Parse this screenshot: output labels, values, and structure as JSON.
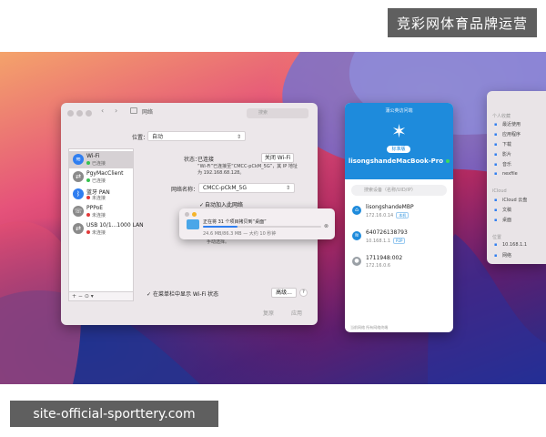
{
  "watermarks": {
    "top": "竞彩网体育品牌运营",
    "bottom": "site-official-sporttery.com"
  },
  "network_window": {
    "title": "网络",
    "search_placeholder": "搜索",
    "location_label": "位置：",
    "location_value": "自动",
    "services": [
      {
        "name": "Wi-Fi",
        "status": "已连接",
        "status_color": "#35c14f",
        "icon": "wifi-icon",
        "glyph": "≋",
        "icon_bg": "#2f7ef0"
      },
      {
        "name": "PgyMacClient",
        "status": "已连接",
        "status_color": "#35c14f",
        "icon": "network-adapter-icon",
        "glyph": "⇄",
        "icon_bg": "#8a8a8a"
      },
      {
        "name": "蓝牙 PAN",
        "status": "未连接",
        "status_color": "#e23b3b",
        "icon": "bluetooth-icon",
        "glyph": "ᛒ",
        "icon_bg": "#2f7ef0"
      },
      {
        "name": "PPPoE",
        "status": "未连接",
        "status_color": "#e23b3b",
        "icon": "phone-icon",
        "glyph": "☏",
        "icon_bg": "#8a8a8a"
      },
      {
        "name": "USB 10/1...1000 LAN",
        "status": "未连接",
        "status_color": "#e23b3b",
        "icon": "ethernet-icon",
        "glyph": "⇄",
        "icon_bg": "#8a8a8a"
      }
    ],
    "sidebar_tools": "+  −  ⊙ ▾",
    "status_label": "状态：",
    "status_value": "已连接",
    "turn_off_wifi": "关闭 Wi-Fi",
    "status_description": "“Wi-Fi”已连接至“CMCC-pCkM_5G”，其 IP 地址为 192.168.68.128。",
    "network_name_label": "网络名称：",
    "network_name_value": "CMCC-pCkM_5G",
    "auto_join_label": "自动加入此网络",
    "ask_text": "手动选择。",
    "show_wifi_label": "在菜单栏中显示 Wi-Fi 状态",
    "advanced_label": "高级...",
    "help_label": "?",
    "revert_label": "复原",
    "apply_label": "应用"
  },
  "copy_dialog": {
    "title": "正在将 31 个项目拷贝到“桌面”",
    "info": "24.6 MB/86.3 MB — 大约 10 秒钟",
    "progress": 0.29
  },
  "peer_panel": {
    "app_title": "蒲公英访问端",
    "badge": "标准版",
    "host_name": "lisongshandeMacBook-Pro",
    "search_placeholder": "搜索设备（名称/UID/IP）",
    "devices": [
      {
        "name": "lisongshandeMBP",
        "ip": "172.16.0.14",
        "tag": "本机",
        "avatar_color": "#1e8bdc",
        "icon": "laptop-icon",
        "glyph": "⌂"
      },
      {
        "name": "640726138793",
        "ip": "10.168.1.1",
        "tag": "P2P",
        "avatar_color": "#1e8bdc",
        "icon": "router-icon",
        "glyph": "≋"
      },
      {
        "name": "1711948:002",
        "ip": "172.16.0.6",
        "tag": "",
        "avatar_color": "#9aa0a6",
        "icon": "user-icon",
        "glyph": "●"
      }
    ],
    "footer": "当前网络  所有网络终端"
  },
  "finder_sidebar": {
    "sections": [
      {
        "title": "个人收藏",
        "items": [
          "最近使用",
          "应用程序",
          "下载",
          "影片",
          "音乐",
          "nexfile"
        ]
      },
      {
        "title": "iCloud",
        "items": [
          "iCloud 云盘",
          "文稿",
          "桌面"
        ]
      },
      {
        "title": "位置",
        "items": [
          "10.168.1.1",
          "网络"
        ]
      }
    ]
  }
}
